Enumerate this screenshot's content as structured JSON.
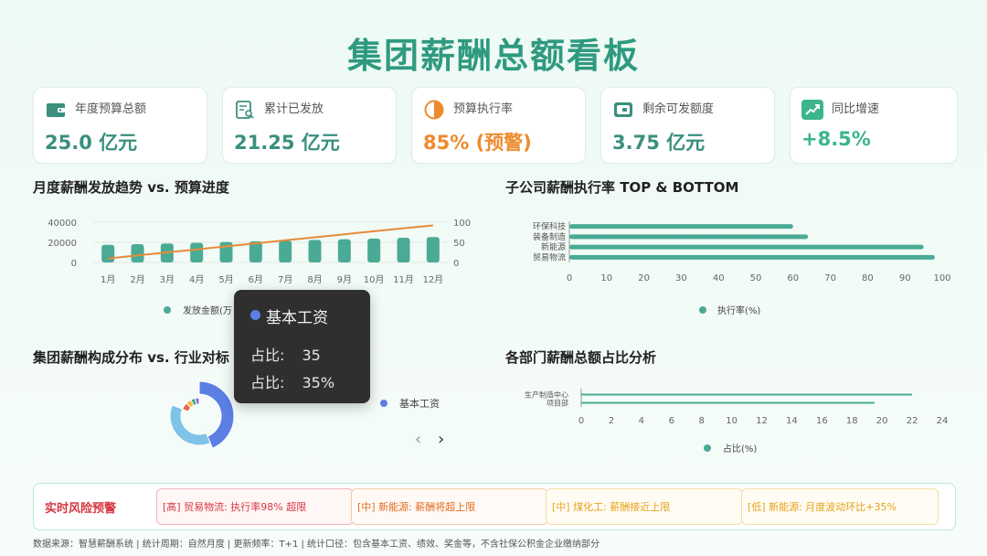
{
  "page_title": "集团薪酬总额看板",
  "kpis": [
    {
      "label": "年度预算总额",
      "value": "25.0 亿元",
      "icon": "wallet-icon",
      "color": "#3a8f7e"
    },
    {
      "label": "累计已发放",
      "value": "21.25 亿元",
      "icon": "document-search-icon",
      "color": "#3a8f7e"
    },
    {
      "label": "预算执行率",
      "value": "85% (预警)",
      "icon": "half-pie-icon",
      "color": "#ee8a2e"
    },
    {
      "label": "剩余可发额度",
      "value": "3.75 亿元",
      "icon": "wallet-icon",
      "color": "#3a8f7e"
    },
    {
      "label": "同比增速",
      "value": "+8.5%",
      "icon": "trend-up-icon",
      "color": "#3cb58a"
    }
  ],
  "sections": {
    "trend": "月度薪酬发放趋势 vs. 预算进度",
    "subsidiary": "子公司薪酬执行率 TOP & BOTTOM",
    "composition": "集团薪酬构成分布 vs. 行业对标",
    "department": "各部门薪酬总额占比分析"
  },
  "chart_data": [
    {
      "type": "bar",
      "categories": [
        "1月",
        "2月",
        "3月",
        "4月",
        "5月",
        "6月",
        "7月",
        "8月",
        "9月",
        "10月",
        "11月",
        "12月"
      ],
      "series": [
        {
          "name": "发放金额(万",
          "type": "bar",
          "values": [
            17500,
            18200,
            18900,
            19600,
            20300,
            21000,
            21700,
            22400,
            23100,
            23800,
            24500,
            25200
          ]
        },
        {
          "type": "line",
          "axis": "right",
          "values": [
            10,
            17.5,
            25,
            32.5,
            40,
            47.5,
            55,
            62.5,
            70,
            77.5,
            85,
            92
          ]
        }
      ],
      "yticks_left": [
        "0",
        "20000",
        "40000"
      ],
      "yticks_right": [
        "0",
        "50",
        "100"
      ],
      "ylim": [
        0,
        40000
      ],
      "ylim_right": [
        0,
        100
      ],
      "colors": {
        "bar": "#4aaa95",
        "line": "#e98a3a"
      }
    },
    {
      "type": "bar",
      "orientation": "horizontal",
      "categories": [
        "环保科技",
        "装备制造",
        "新能源",
        "贸易物流"
      ],
      "series": [
        {
          "name": "执行率(%)",
          "values": [
            60,
            64,
            95,
            98
          ]
        }
      ],
      "xticks": [
        "0",
        "10",
        "20",
        "30",
        "40",
        "50",
        "60",
        "70",
        "80",
        "90",
        "100"
      ],
      "xlim": [
        0,
        100
      ],
      "colors": {
        "bar": "#4aaa95"
      }
    },
    {
      "type": "pie",
      "legend": [
        {
          "name": "基本工资",
          "color": "#5b7fe3"
        }
      ],
      "slices": [
        {
          "name": "基本工资",
          "value": 35,
          "color": "#5b7fe3"
        },
        {
          "value": 30,
          "color": "#7fc4e8"
        },
        {
          "value": 5,
          "color": "#e36a4a"
        },
        {
          "value": 4,
          "color": "#f2b648"
        },
        {
          "value": 3,
          "color": "#3aa87a"
        },
        {
          "value": 3,
          "color": "#9a6ae0"
        }
      ]
    },
    {
      "type": "bar",
      "orientation": "horizontal",
      "categories": [
        "项目部",
        "生产制造中心"
      ],
      "series": [
        {
          "name": "占比(%)",
          "values": [
            19.5,
            22
          ]
        }
      ],
      "xticks": [
        "0",
        "2",
        "4",
        "6",
        "8",
        "10",
        "12",
        "14",
        "16",
        "18",
        "20",
        "22",
        "24"
      ],
      "xlim": [
        0,
        24
      ],
      "colors": {
        "bar": "#4aaa95"
      }
    }
  ],
  "tooltip": {
    "title": "基本工资",
    "row1_label": "占比:",
    "row1_value": "35",
    "row2_label": "占比:",
    "row2_value": "35%"
  },
  "nav": {
    "prev": "‹",
    "next": "›"
  },
  "alerts": {
    "title": "实时风险预警",
    "items": [
      {
        "text": "[高] 贸易物流: 执行率98% 超限",
        "color": "#d7363f",
        "bg": "#fff6f6",
        "border": "#f1b5b8"
      },
      {
        "text": "[中] 新能源: 薪酬将超上限",
        "color": "#e06c1f",
        "bg": "#fffaf5",
        "border": "#f3c9a7"
      },
      {
        "text": "[中] 煤化工: 薪酬接近上限",
        "color": "#e7a21c",
        "bg": "#fffcf3",
        "border": "#f3dea3"
      },
      {
        "text": "[低] 新能源: 月度波动环比+35%",
        "color": "#e7a21c",
        "bg": "#fffcf3",
        "border": "#f3dea3"
      }
    ]
  },
  "footer": "数据来源：智慧薪酬系统 | 统计周期：自然月度 | 更新频率：T+1 | 统计口径：包含基本工资、绩效、奖金等，不含社保公积金企业缴纳部分"
}
